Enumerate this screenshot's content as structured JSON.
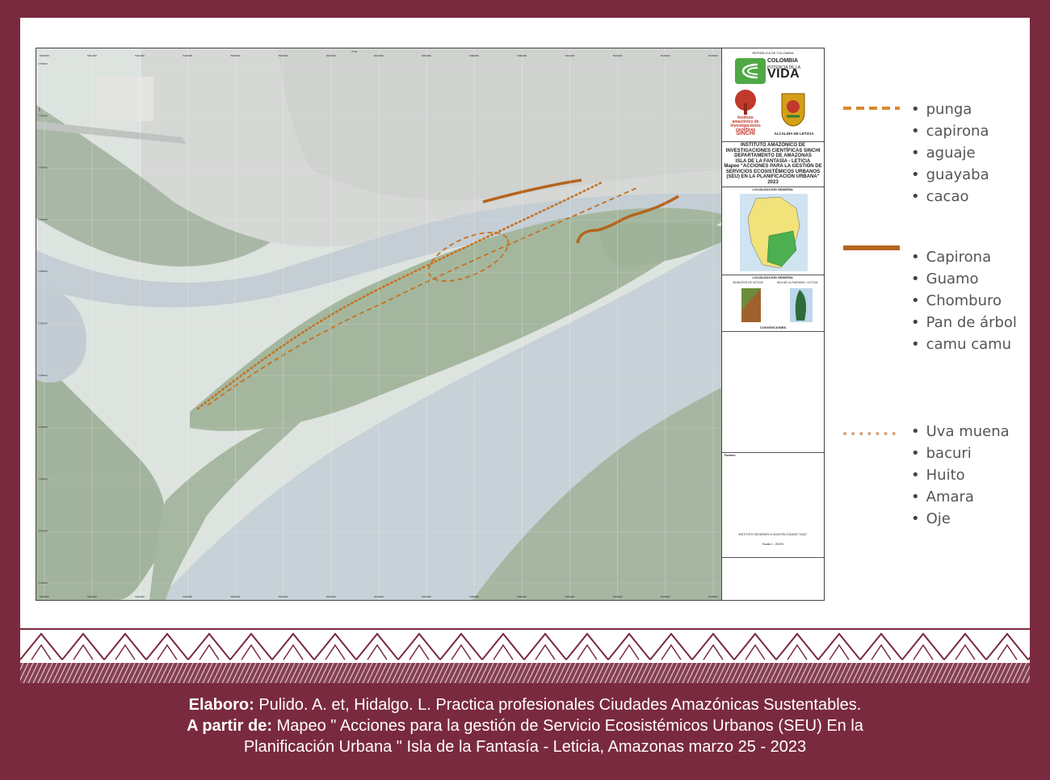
{
  "map": {
    "top_meridian_label": "70°W",
    "left_parallel_label": "4°S",
    "x_coords": [
      "5320000",
      "5322000",
      "5324000",
      "5326000",
      "5328000",
      "5330000",
      "5332000",
      "5334000",
      "5336000",
      "5338000",
      "5340000",
      "5342000",
      "5344000",
      "5346000",
      "5348000"
    ],
    "y_coords": [
      "1760000",
      "1758000",
      "1756000",
      "1754000",
      "1752000",
      "1750000",
      "1748000",
      "1746000",
      "1744000",
      "1742000",
      "1740000"
    ]
  },
  "panel": {
    "republic": "REPÚBLICA DE COLOMBIA",
    "colombia_line1": "COLOMBIA",
    "colombia_line2": "POTENCIA DE LA",
    "colombia_line3": "VIDA",
    "instituto_logo": "Instituto amazónico de investigaciones científicas",
    "sinchi": "SINCHI",
    "alcaldia": "ALCALDÍA DE LETICIA",
    "title_block": [
      "INSTITUTO AMAZÓNICO DE",
      "INVESTIGACIONES CIENTÍFICAS SINCHI",
      "DEPARTAMENTO DE AMAZONAS",
      "ISLA DE LA FANTASÍA - LETICIA",
      "Mapeo \"ACCIONES PARA LA GESTIÓN DE",
      "SERVICIOS ECOSISTÉMICOS URBANOS",
      "(SEU) EN LA PLANIFICACIÓN URBANA\"",
      "2023"
    ],
    "localizacion_general": "LOCALIZACIÓN GENERAL",
    "localizacion_general_2": "LOCALIZACIÓN GENERAL",
    "municipio": "MUNICIPIO DE LETICIA",
    "isla": "ISLA DE LA FANTASÍA - LETICIA",
    "convenciones": "CONVENCIONES",
    "fuentes": "Fuentes:",
    "instituto_footer": "INSTITUTO GEOGRÁFICO AGUSTÍN CODAZZI \"IGAC\"",
    "escala": "Escala 1 : 25.000"
  },
  "legend": {
    "groups": [
      {
        "style": "dashed",
        "color": "#d98a2e",
        "items": [
          "punga",
          "capirona",
          "aguaje",
          "guayaba",
          "cacao"
        ]
      },
      {
        "style": "solid",
        "color": "#b5651d",
        "items": [
          "Capirona",
          "Guamo",
          "Chomburo",
          "Pan de árbol",
          "camu camu"
        ]
      },
      {
        "style": "dotted",
        "color": "#d9a37a",
        "items": [
          "Uva muena",
          "bacuri",
          "Huito",
          "Amara",
          "Oje"
        ]
      }
    ]
  },
  "caption": {
    "line1_bold": "Elaboro:",
    "line1_rest": " Pulido. A.  et, Hidalgo. L. Practica profesionales Ciudades Amazónicas Sustentables.",
    "line2_bold": "A partir de:",
    "line2_rest": " Mapeo \" Acciones para la gestión de Servicio Ecosistémicos Urbanos (SEU) En la",
    "line3": "Planificación Urbana \" Isla de la Fantasía - Leticia, Amazonas marzo 25 - 2023"
  },
  "colors": {
    "background": "#7a2a3f",
    "river": "#c9d3da",
    "vegetation": "#9fb39a",
    "route_orange": "#c7701e"
  }
}
